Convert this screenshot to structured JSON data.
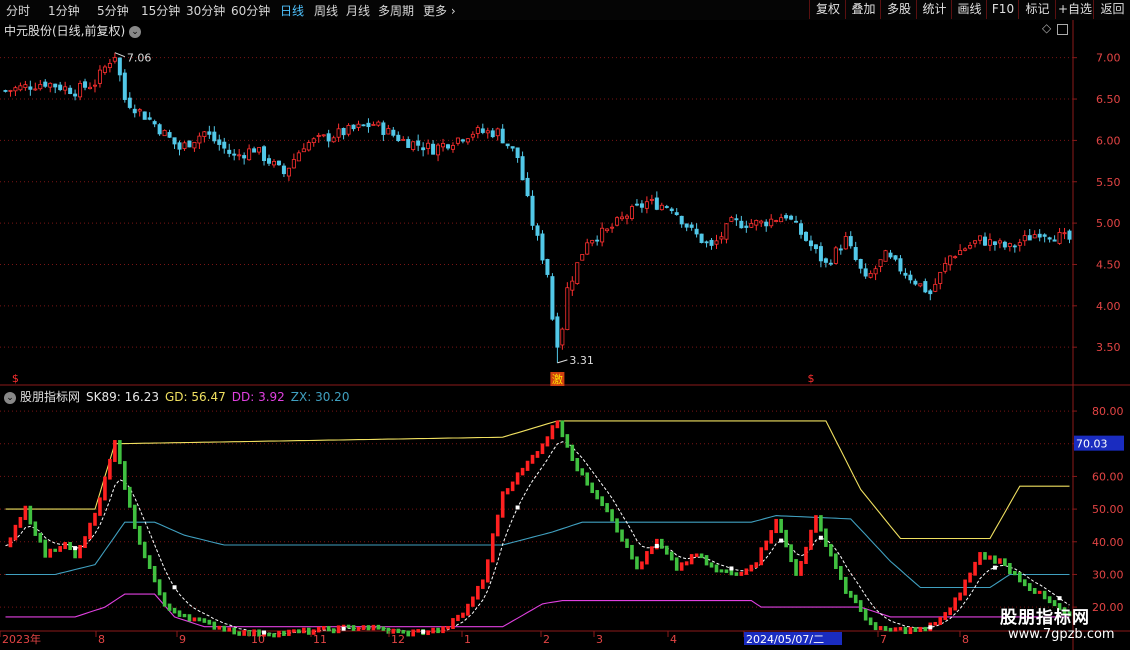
{
  "toolbar": {
    "timeframes": [
      {
        "label": "分时",
        "active": false
      },
      {
        "label": "1分钟",
        "active": false
      },
      {
        "label": "5分钟",
        "active": false
      },
      {
        "label": "15分钟",
        "active": false
      },
      {
        "label": "30分钟",
        "active": false
      },
      {
        "label": "60分钟",
        "active": false
      },
      {
        "label": "日线",
        "active": true
      },
      {
        "label": "周线",
        "active": false
      },
      {
        "label": "月线",
        "active": false
      },
      {
        "label": "多周期",
        "active": false
      },
      {
        "label": "更多",
        "active": false
      }
    ],
    "more_icon": "chevron-right-icon",
    "buttons": [
      "复权",
      "叠加",
      "多股",
      "统计",
      "画线",
      "F10",
      "标记",
      "+自选",
      "返回"
    ]
  },
  "price_panel": {
    "title": "中元股份(日线,前复权)",
    "title_icon": "chevron-down-icon",
    "corner_icon": "diamond-icon",
    "high_label": "7.06",
    "low_label": "3.31",
    "low_marker": "激",
    "yticks": [
      "7.00",
      "6.50",
      "6.00",
      "5.50",
      "5.00",
      "4.50",
      "4.00",
      "3.50"
    ],
    "yticks_values": [
      7.0,
      6.5,
      6.0,
      5.5,
      5.0,
      4.5,
      4.0,
      3.5
    ],
    "event_markers": [
      "$",
      "$"
    ]
  },
  "indicator_panel": {
    "title": "股朋指标网",
    "title_icon": "chevron-down-icon",
    "fields": [
      {
        "label": "SK89: 16.23",
        "color": "#e8e8e8"
      },
      {
        "label": "GD: 56.47",
        "color": "#f0e060"
      },
      {
        "label": "DD: 3.92",
        "color": "#e040e0"
      },
      {
        "label": "ZX: 30.20",
        "color": "#40a0c0"
      }
    ],
    "yticks": [
      "80.00",
      "70.00",
      "60.00",
      "50.00",
      "40.00",
      "30.00",
      "20.00"
    ],
    "current_value": "70.03"
  },
  "xaxis": {
    "labels": [
      "2023年",
      "8",
      "9",
      "10",
      "11",
      "12",
      "1",
      "2",
      "3",
      "4",
      "2024/05/07/二",
      "7",
      "8"
    ]
  },
  "colors": {
    "up": "#ff3030",
    "down": "#52c8e8",
    "ind_up": "#ff2020",
    "ind_down": "#40c040",
    "gd": "#f0e060",
    "dd": "#e040e0",
    "zx": "#40a0c0",
    "grid": "#7a1515",
    "axis": "#8b1a1a"
  },
  "watermark": {
    "title": "股朋指标网",
    "url": "www.7gpzb.com"
  },
  "chart_data": [
    {
      "type": "candlestick",
      "title": "中元股份(日线,前复权)",
      "ylim": [
        3.2,
        7.25
      ],
      "x_range": [
        "2023-07",
        "2024-08"
      ],
      "anchors": [
        [
          0,
          6.6
        ],
        [
          8,
          6.7
        ],
        [
          14,
          6.6
        ],
        [
          18,
          6.7
        ],
        [
          22,
          7.06
        ],
        [
          24,
          6.5
        ],
        [
          30,
          6.2
        ],
        [
          35,
          5.9
        ],
        [
          40,
          6.1
        ],
        [
          46,
          5.8
        ],
        [
          50,
          5.9
        ],
        [
          56,
          5.6
        ],
        [
          60,
          5.95
        ],
        [
          68,
          6.1
        ],
        [
          74,
          6.2
        ],
        [
          80,
          6.0
        ],
        [
          86,
          5.9
        ],
        [
          94,
          6.1
        ],
        [
          99,
          6.1
        ],
        [
          103,
          5.8
        ],
        [
          106,
          5.0
        ],
        [
          109,
          4.4
        ],
        [
          111,
          3.31
        ],
        [
          113,
          4.2
        ],
        [
          117,
          4.8
        ],
        [
          121,
          4.9
        ],
        [
          125,
          5.1
        ],
        [
          129,
          5.25
        ],
        [
          134,
          5.2
        ],
        [
          138,
          4.9
        ],
        [
          142,
          4.7
        ],
        [
          146,
          5.0
        ],
        [
          152,
          5.0
        ],
        [
          157,
          5.1
        ],
        [
          161,
          4.8
        ],
        [
          165,
          4.5
        ],
        [
          169,
          4.8
        ],
        [
          173,
          4.3
        ],
        [
          177,
          4.6
        ],
        [
          181,
          4.4
        ],
        [
          186,
          4.15
        ],
        [
          190,
          4.6
        ],
        [
          196,
          4.8
        ],
        [
          202,
          4.7
        ],
        [
          208,
          4.9
        ],
        [
          214,
          4.8
        ]
      ],
      "high_point": 7.06,
      "low_point": 3.31
    },
    {
      "type": "line",
      "title": "股朋指标网",
      "ylim": [
        13,
        84
      ],
      "series": [
        {
          "name": "SK89",
          "values_anchors": [
            [
              0,
              38
            ],
            [
              4,
              50
            ],
            [
              8,
              36
            ],
            [
              12,
              40
            ],
            [
              14,
              35
            ],
            [
              18,
              48
            ],
            [
              22,
              70
            ],
            [
              26,
              44
            ],
            [
              32,
              20
            ],
            [
              40,
              15
            ],
            [
              48,
              12
            ],
            [
              56,
              12
            ],
            [
              64,
              13
            ],
            [
              72,
              14
            ],
            [
              80,
              12
            ],
            [
              88,
              13
            ],
            [
              92,
              18
            ],
            [
              96,
              28
            ],
            [
              100,
              55
            ],
            [
              104,
              62
            ],
            [
              108,
              70
            ],
            [
              111,
              77
            ],
            [
              115,
              62
            ],
            [
              121,
              50
            ],
            [
              127,
              32
            ],
            [
              131,
              40
            ],
            [
              135,
              32
            ],
            [
              139,
              36
            ],
            [
              143,
              31
            ],
            [
              147,
              30
            ],
            [
              151,
              34
            ],
            [
              155,
              47
            ],
            [
              159,
              30
            ],
            [
              163,
              47
            ],
            [
              169,
              25
            ],
            [
              175,
              13
            ],
            [
              185,
              13
            ],
            [
              190,
              19
            ],
            [
              196,
              36
            ],
            [
              200,
              34
            ],
            [
              206,
              26
            ],
            [
              214,
              17
            ]
          ],
          "last": 16.23
        },
        {
          "name": "GD",
          "values_anchors": [
            [
              0,
              50
            ],
            [
              18,
              50
            ],
            [
              22,
              70
            ],
            [
              100,
              72
            ],
            [
              111,
              77
            ],
            [
              165,
              77
            ],
            [
              172,
              56
            ],
            [
              180,
              41
            ],
            [
              198,
              41
            ],
            [
              204,
              57
            ],
            [
              214,
              57
            ]
          ],
          "last": 56.47
        },
        {
          "name": "DD",
          "values_anchors": [
            [
              0,
              17
            ],
            [
              14,
              17
            ],
            [
              20,
              20
            ],
            [
              24,
              24
            ],
            [
              30,
              24
            ],
            [
              34,
              17
            ],
            [
              40,
              14
            ],
            [
              100,
              14
            ],
            [
              108,
              21
            ],
            [
              112,
              22
            ],
            [
              150,
              22
            ],
            [
              152,
              20
            ],
            [
              172,
              20
            ],
            [
              178,
              17
            ],
            [
              214,
              17
            ]
          ],
          "last": 3.92
        },
        {
          "name": "ZX",
          "values_anchors": [
            [
              0,
              30
            ],
            [
              10,
              30
            ],
            [
              18,
              33
            ],
            [
              24,
              46
            ],
            [
              30,
              46
            ],
            [
              36,
              42
            ],
            [
              44,
              39
            ],
            [
              70,
              39
            ],
            [
              100,
              39
            ],
            [
              110,
              43
            ],
            [
              116,
              46
            ],
            [
              150,
              46
            ],
            [
              155,
              48
            ],
            [
              170,
              47
            ],
            [
              178,
              34
            ],
            [
              184,
              26
            ],
            [
              198,
              26
            ],
            [
              202,
              30
            ],
            [
              214,
              30
            ]
          ],
          "last": 30.2
        }
      ]
    }
  ]
}
